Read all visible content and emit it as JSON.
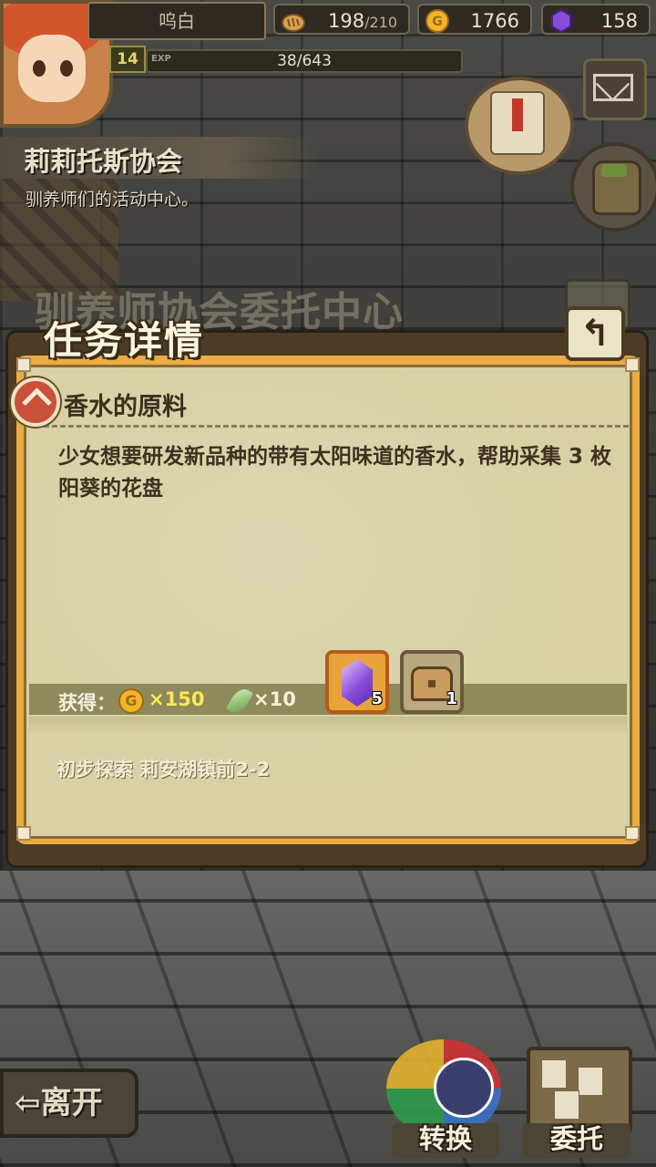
{
  "player": {
    "name": "呜白",
    "level": "14",
    "exp_label": "EXP",
    "exp_text": "38/643",
    "exp_fraction": 0.059
  },
  "resources": {
    "bread_current": "198",
    "bread_max": "/210",
    "gold": "1766",
    "gems": "158"
  },
  "location": {
    "title": "莉莉托斯协会",
    "subtitle": "驯养师们的活动中心。"
  },
  "background_title": "驯养师协会委托中心",
  "dialog": {
    "title": "任务详情",
    "back_glyph": "↰",
    "quest_name": "香水的原料",
    "quest_description": "少女想要研发新品种的带有太阳味道的香水，帮助采集 3 枚阳葵的花盘",
    "reward_label": "获得：",
    "coin_glyph": "G",
    "coin_amount": "×150",
    "feather_amount": "×10",
    "items": [
      {
        "name": "purple-gem",
        "count": "5"
      },
      {
        "name": "treasure-chest",
        "count": "1"
      }
    ],
    "location_text": "初步探索 莉安湖镇前2-2"
  },
  "buttons": {
    "leave": "⇦离开",
    "swap": "转换",
    "commission": "委托"
  },
  "colors": {
    "accent_orange": "#ebac42",
    "parchment": "#d7d1a5",
    "coin_text": "#ffe95a"
  },
  "icons": [
    "bread-icon",
    "gold-coin-icon",
    "purple-gem-icon",
    "mail-icon",
    "quest-scroll-icon",
    "backpack-icon",
    "back-arrow-icon",
    "quest-marker-icon",
    "feather-icon",
    "treasure-chest-icon"
  ]
}
